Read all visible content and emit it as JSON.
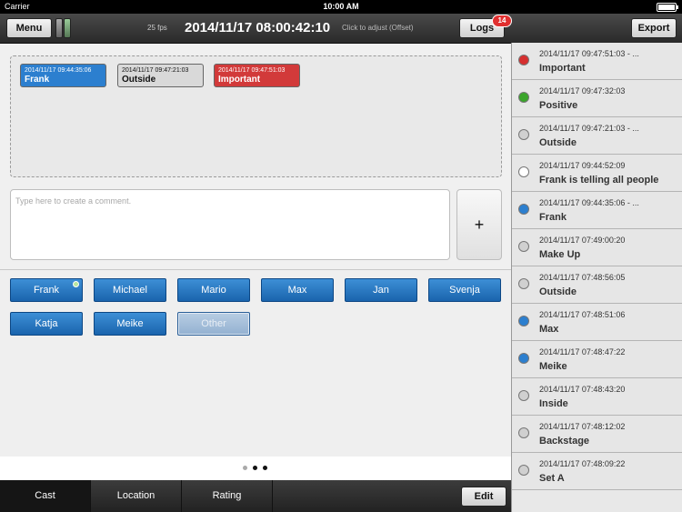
{
  "status_bar": {
    "carrier": "Carrier",
    "time": "10:00 AM"
  },
  "toolbar": {
    "menu_label": "Menu",
    "fps": "25 fps",
    "timecode": "2014/11/17 08:00:42:10",
    "adjust_hint": "Click to adjust (Offset)",
    "logs_label": "Logs",
    "logs_count": "14",
    "export_label": "Export"
  },
  "timeline_tags": [
    {
      "time": "2014/11/17 09:44:35:06",
      "label": "Frank",
      "color": "#2c7fcf"
    },
    {
      "time": "2014/11/17 09:47:21:03",
      "label": "Outside",
      "color": "#d9d9d9"
    },
    {
      "time": "2014/11/17 09:47:51:03",
      "label": "Important",
      "color": "#d23a3a"
    }
  ],
  "comment": {
    "placeholder": "Type here to create a comment.",
    "add_label": "+"
  },
  "cast": [
    {
      "label": "Frank",
      "active": true
    },
    {
      "label": "Michael"
    },
    {
      "label": "Mario"
    },
    {
      "label": "Max"
    },
    {
      "label": "Jan"
    },
    {
      "label": "Svenja"
    },
    {
      "label": "Katja"
    },
    {
      "label": "Meike"
    },
    {
      "label": "Other",
      "disabled": true
    }
  ],
  "pager": {
    "pages": 3,
    "current": 1
  },
  "bottom_tabs": [
    {
      "label": "Cast",
      "active": true
    },
    {
      "label": "Location"
    },
    {
      "label": "Rating"
    }
  ],
  "edit_label": "Edit",
  "logs": [
    {
      "time": "2014/11/17 09:47:51:03 - ...",
      "label": "Important",
      "color": "#d62f2f"
    },
    {
      "time": "2014/11/17 09:47:32:03",
      "label": "Positive",
      "color": "#3aa52a"
    },
    {
      "time": "2014/11/17 09:47:21:03 - ...",
      "label": "Outside",
      "color": "#d0d0d0"
    },
    {
      "time": "2014/11/17 09:44:52:09",
      "label": "Frank is telling all people",
      "color": "#ffffff"
    },
    {
      "time": "2014/11/17 09:44:35:06 - ...",
      "label": "Frank",
      "color": "#2c7fcf"
    },
    {
      "time": "2014/11/17 07:49:00:20",
      "label": "Make Up",
      "color": "#d0d0d0"
    },
    {
      "time": "2014/11/17 07:48:56:05",
      "label": "Outside",
      "color": "#d0d0d0"
    },
    {
      "time": "2014/11/17 07:48:51:06",
      "label": "Max",
      "color": "#2c7fcf"
    },
    {
      "time": "2014/11/17 07:48:47:22",
      "label": "Meike",
      "color": "#2c7fcf"
    },
    {
      "time": "2014/11/17 07:48:43:20",
      "label": "Inside",
      "color": "#d0d0d0"
    },
    {
      "time": "2014/11/17 07:48:12:02",
      "label": "Backstage",
      "color": "#d0d0d0"
    },
    {
      "time": "2014/11/17 07:48:09:22",
      "label": "Set A",
      "color": "#d0d0d0"
    }
  ]
}
